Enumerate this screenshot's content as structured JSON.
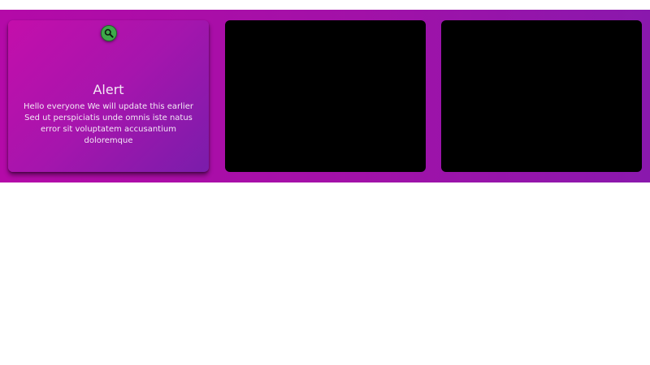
{
  "cards": [
    {
      "icon": "search-icon",
      "title": "Alert",
      "text": "Hello everyone We will update this earlier Sed ut perspiciatis unde omnis iste natus error sit voluptatem accusantium doloremque"
    },
    {
      "content": ""
    },
    {
      "content": ""
    }
  ],
  "colors": {
    "band_start": "#b40aa8",
    "band_end": "#8a18ad",
    "card_gradient_start": "#c40eab",
    "card_gradient_end": "#7a1dab",
    "icon_badge": "#3fa84a",
    "dark_card": "#000000",
    "text": "#f4e9f6"
  }
}
